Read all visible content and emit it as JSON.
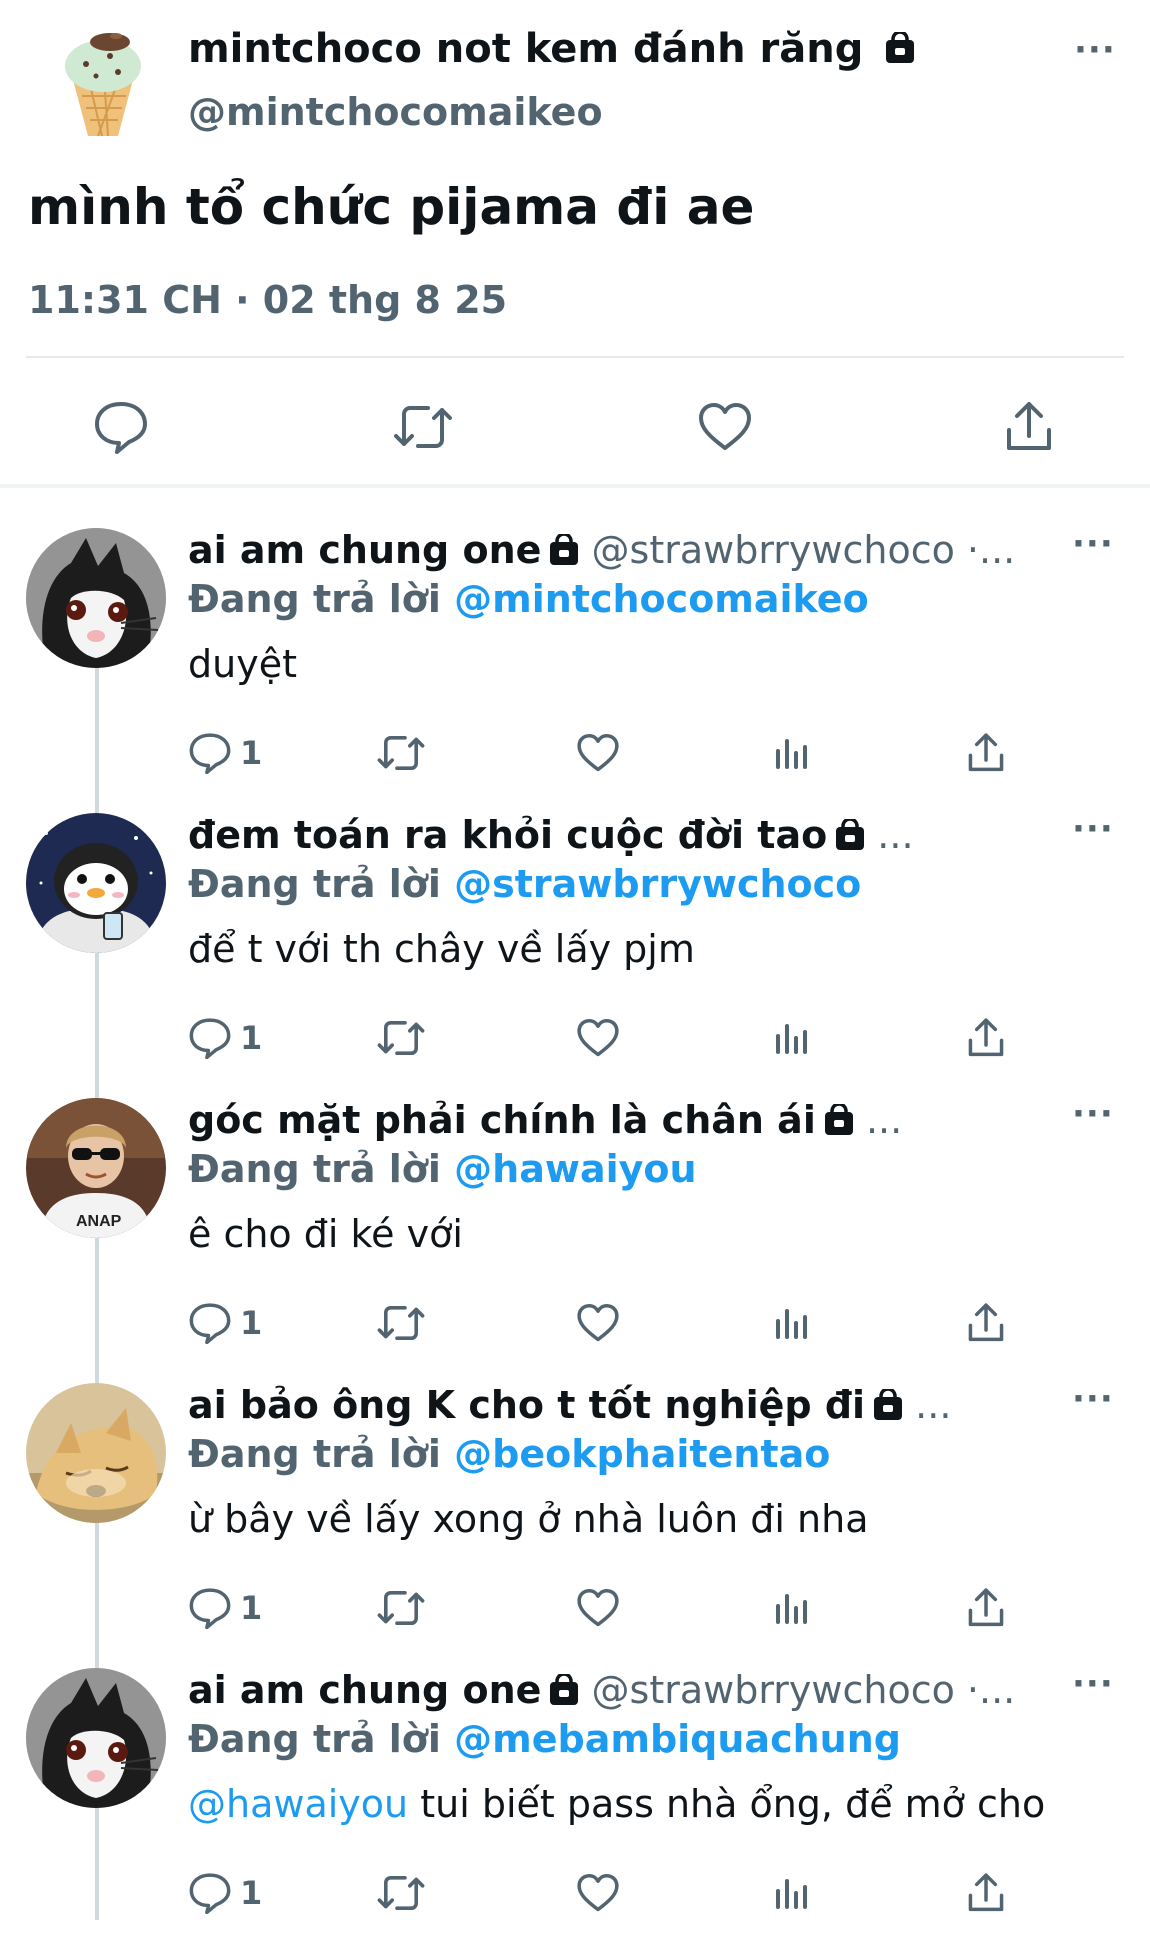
{
  "main_tweet": {
    "display_name": "mintchoco not kem đánh răng",
    "handle": "@mintchocomaikeo",
    "text": "mình tổ chức pijama đi ae",
    "timestamp": "11:31 CH · 02 thg 8 25",
    "more_label": "···",
    "actions": [
      "reply-icon",
      "retweet-icon",
      "like-icon",
      "share-icon"
    ]
  },
  "replying_label": "Đang trả lời",
  "replies": [
    {
      "display_name": "ai am chung one",
      "handle": "@strawbrrywchoco",
      "handle_suffix": " ·...",
      "replying_to": "@mintchocomaikeo",
      "mention": "",
      "text": "duyệt",
      "reply_count": "1",
      "avatar": "cat-avatar"
    },
    {
      "display_name": "đem toán ra khỏi cuộc đời tao",
      "handle": "",
      "handle_suffix": " ...",
      "replying_to": "@strawbrrywchoco",
      "mention": "",
      "text": "để t với th chây về lấy pjm",
      "reply_count": "1",
      "avatar": "penguin-avatar"
    },
    {
      "display_name": "góc mặt phải chính là chân ái",
      "handle": "",
      "handle_suffix": " ...",
      "replying_to": "@hawaiyou",
      "mention": "",
      "text": "ê cho đi ké với",
      "reply_count": "1",
      "avatar": "person-avatar"
    },
    {
      "display_name": "ai bảo ông K cho t tốt nghiệp đi",
      "handle": "",
      "handle_suffix": " ...",
      "replying_to": "@beokphaitentao",
      "mention": "",
      "text": "ừ bây về lấy xong ở nhà luôn đi nha",
      "reply_count": "1",
      "avatar": "dog-avatar"
    },
    {
      "display_name": "ai am chung one",
      "handle": "@strawbrrywchoco",
      "handle_suffix": " ·...",
      "replying_to": "@mebambiquachung",
      "mention": "@hawaiyou",
      "text": " tui biết pass nhà ổng, để mở cho",
      "reply_count": "1",
      "avatar": "cat-avatar"
    }
  ],
  "colors": {
    "link": "#1d9bf0",
    "secondary_text": "#536471",
    "primary_text": "#0f1419",
    "divider": "#e6e9ec"
  }
}
